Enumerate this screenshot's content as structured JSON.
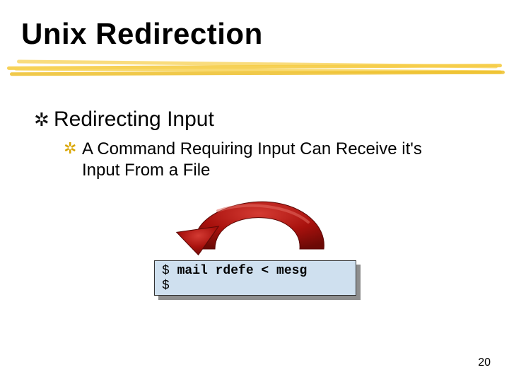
{
  "title": "Unix Redirection",
  "bullets": {
    "level1": {
      "glyph": "✲",
      "text": "Redirecting Input"
    },
    "level2": {
      "glyph": "✲",
      "text": "A Command Requiring Input Can Receive it's Input From a File"
    }
  },
  "code": {
    "prompt1": "$ ",
    "command": "mail rdefe < mesg",
    "prompt2": "$"
  },
  "page_number": "20",
  "colors": {
    "underline": "#f4c93a",
    "arrow_fill": "#a8110d",
    "arrow_edge": "#7c0b07",
    "code_bg": "#cfe0ef",
    "shadow": "#8e8e8e",
    "sub_bullet_glyph": "#d9a500"
  }
}
